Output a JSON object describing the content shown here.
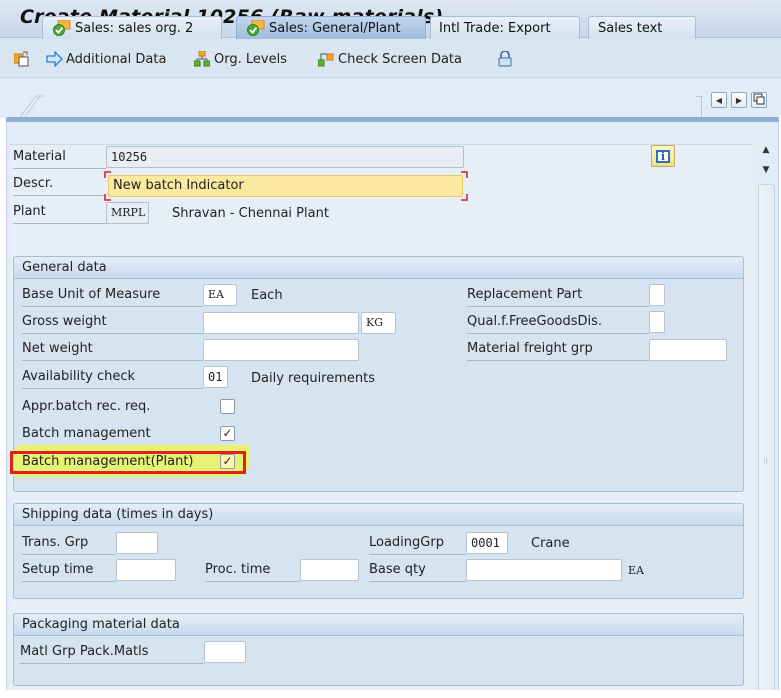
{
  "window": {
    "title": "Create Material 10256 (Raw materials)"
  },
  "toolbar": {
    "items": [
      {
        "id": "copy-from",
        "label": "",
        "icon": "copy-document-icon"
      },
      {
        "id": "additional-data",
        "label": "Additional Data",
        "icon": "arrow-right-icon"
      },
      {
        "id": "org-levels",
        "label": "Org. Levels",
        "icon": "hierarchy-icon"
      },
      {
        "id": "check-screen-data",
        "label": "Check Screen Data",
        "icon": "check-data-icon"
      },
      {
        "id": "lock",
        "label": "",
        "icon": "lock-icon"
      }
    ]
  },
  "tabs": [
    {
      "label": "Sales: sales org. 2",
      "status": "complete",
      "active": false
    },
    {
      "label": "Sales: General/Plant",
      "status": "complete",
      "active": true
    },
    {
      "label": "Intl Trade: Export",
      "active": false
    },
    {
      "label": "Sales text",
      "active": false
    }
  ],
  "tab_nav": {
    "prev": "◀",
    "next": "▶",
    "list": "tab-list-icon"
  },
  "header": {
    "material_label": "Material",
    "material_value": "10256",
    "descr_label": "Descr.",
    "descr_value": "New batch Indicator",
    "plant_label": "Plant",
    "plant_value": "MRPL",
    "plant_name": "Shravan - Chennai Plant"
  },
  "general_data": {
    "title": "General data",
    "base_uom_label": "Base Unit of Measure",
    "base_uom_value": "EA",
    "base_uom_text": "Each",
    "gross_weight_label": "Gross weight",
    "gross_weight_value": "",
    "weight_unit": "KG",
    "net_weight_label": "Net weight",
    "net_weight_value": "",
    "availability_label": "Availability check",
    "availability_value": "01",
    "availability_text": "Daily requirements",
    "appr_batch_label": "Appr.batch rec. req.",
    "appr_batch_checked": false,
    "batch_mgmt_label": "Batch management",
    "batch_mgmt_checked": true,
    "batch_mgmt_plant_label": "Batch management(Plant)",
    "batch_mgmt_plant_checked": true,
    "replacement_part_label": "Replacement Part",
    "replacement_part_value": "",
    "qual_free_goods_label": "Qual.f.FreeGoodsDis.",
    "qual_free_goods_value": "",
    "material_freight_label": "Material freight grp",
    "material_freight_value": ""
  },
  "shipping_data": {
    "title": "Shipping data (times in days)",
    "trans_grp_label": "Trans. Grp",
    "trans_grp_value": "",
    "loading_grp_label": "LoadingGrp",
    "loading_grp_value": "0001",
    "loading_grp_text": "Crane",
    "setup_time_label": "Setup time",
    "setup_time_value": "",
    "proc_time_label": "Proc. time",
    "proc_time_value": "",
    "base_qty_label": "Base qty",
    "base_qty_value": "",
    "base_qty_unit": "EA"
  },
  "packaging_data": {
    "title": "Packaging material data",
    "matl_grp_label": "Matl Grp Pack.Matls",
    "matl_grp_value": ""
  },
  "checkmark": "✓",
  "colors": {
    "highlight": "#e8f26a",
    "annotation_box": "#e02020",
    "focus_field": "#fbe9a0"
  }
}
